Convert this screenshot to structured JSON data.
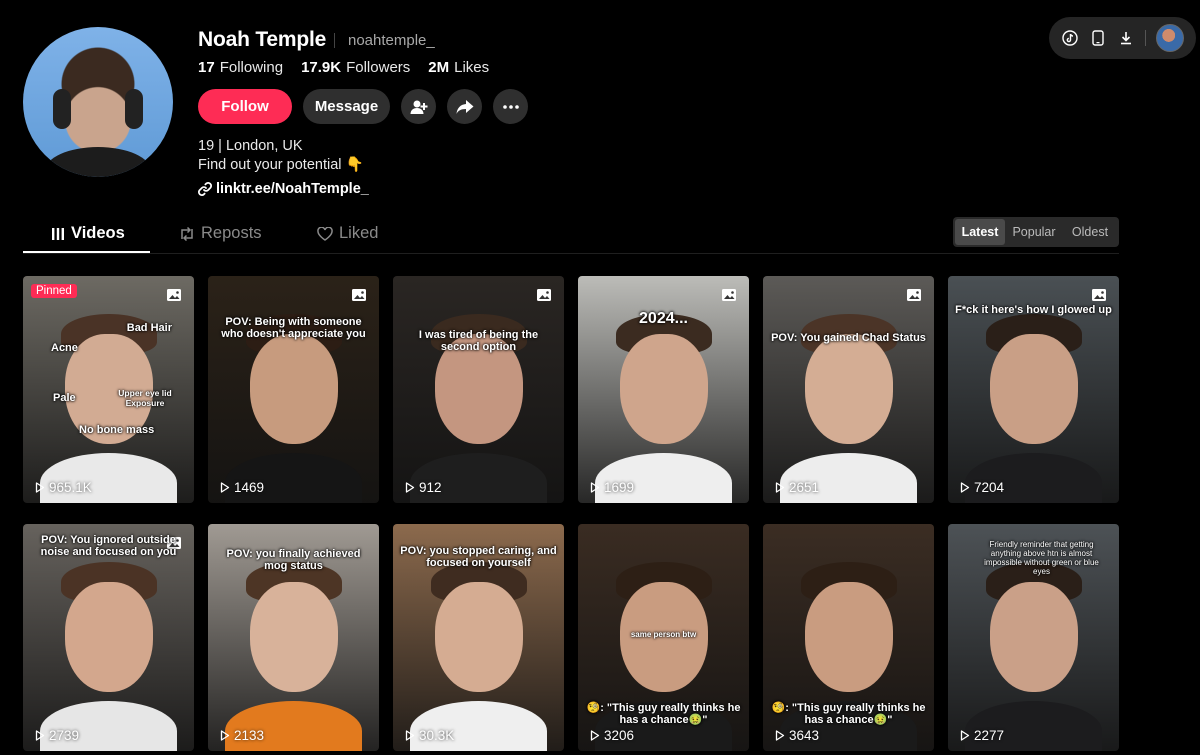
{
  "profile": {
    "name": "Noah Temple",
    "handle": "noahtemple_",
    "stats": [
      {
        "value": "17",
        "label": "Following"
      },
      {
        "value": "17.9K",
        "label": "Followers"
      },
      {
        "value": "2M",
        "label": "Likes"
      }
    ],
    "follow_label": "Follow",
    "message_label": "Message",
    "bio_line1": "19 | London, UK",
    "bio_line2": "Find out your potential 👇",
    "link": "linktr.ee/NoahTemple_"
  },
  "tabs": [
    {
      "label": "Videos",
      "icon": "grid-icon"
    },
    {
      "label": "Reposts",
      "icon": "repost-icon"
    },
    {
      "label": "Liked",
      "icon": "heart-icon"
    }
  ],
  "sort": [
    "Latest",
    "Popular",
    "Oldest"
  ],
  "videos": [
    {
      "views": "965.1K",
      "pinned": "Pinned",
      "texts": [
        "Bad Hair",
        "Acne",
        "Pale",
        "Upper eye lid Exposure",
        "No bone mass"
      ],
      "bg": "#6d6a63",
      "skin": "#d2ab93",
      "hair": "#4a3326",
      "shirt": "#e9e9e9"
    },
    {
      "views": "1469",
      "texts": [
        "POV: Being with someone who doesn't appreciate you"
      ],
      "bg": "#2b2218",
      "skin": "#c79b7e",
      "hair": "#2c1d14",
      "shirt": "#151515"
    },
    {
      "views": "912",
      "texts": [
        "I was tired of being the second option"
      ],
      "bg": "#2a2623",
      "skin": "#c49680",
      "hair": "#3a2a1f",
      "shirt": "#1e1e1e"
    },
    {
      "views": "1699",
      "texts": [
        "2024..."
      ],
      "bg": "#bcbcb8",
      "skin": "#cfa58c",
      "hair": "#3b2b20",
      "shirt": "#eeeeee"
    },
    {
      "views": "2651",
      "texts": [
        "POV: You gained Chad Status"
      ],
      "bg": "#5c5a57",
      "skin": "#d4ad94",
      "hair": "#4b3427",
      "shirt": "#ededed"
    },
    {
      "views": "7204",
      "texts": [
        "F*ck it here's how I glowed up"
      ],
      "bg": "#4a5054",
      "skin": "#c99f86",
      "hair": "#2a1f18",
      "shirt": "#1c1c1e"
    },
    {
      "views": "2739",
      "texts": [
        "POV: You ignored outside noise and focused on you"
      ],
      "bg": "#66625d",
      "skin": "#d3a78d",
      "hair": "#4b3325",
      "shirt": "#e6e6e6"
    },
    {
      "views": "2133",
      "texts": [
        "POV: you finally achieved mog status"
      ],
      "bg": "#a09a93",
      "skin": "#d8b29a",
      "hair": "#4d3525",
      "shirt": "#e27a1e"
    },
    {
      "views": "30.3K",
      "texts": [
        "POV: you stopped caring, and focused on yourself"
      ],
      "bg": "#8c6a4d",
      "skin": "#d5ac92",
      "hair": "#3f2c20",
      "shirt": "#efefef"
    },
    {
      "views": "3206",
      "texts": [
        "same person btw",
        "🧐: \"This guy really thinks he has a chance🤢\""
      ],
      "bg": "#3a2c22",
      "skin": "#c99c80",
      "hair": "#2d1f15",
      "shirt": "#1a1a1a"
    },
    {
      "views": "3643",
      "texts": [
        "🧐: \"This guy really thinks he has a chance🤢\""
      ],
      "bg": "#3b2d23",
      "skin": "#c99c80",
      "hair": "#2d1f15",
      "shirt": "#1a1a1a"
    },
    {
      "views": "2277",
      "texts": [
        "Friendly reminder that getting anything above htn is almost impossible without green or blue eyes"
      ],
      "bg": "#4d5256",
      "skin": "#caa088",
      "hair": "#2a1f18",
      "shirt": "#1c1c1e"
    }
  ],
  "colors": {
    "accent": "#fe2c55",
    "bg": "#000000",
    "button": "#2f2f2f"
  }
}
